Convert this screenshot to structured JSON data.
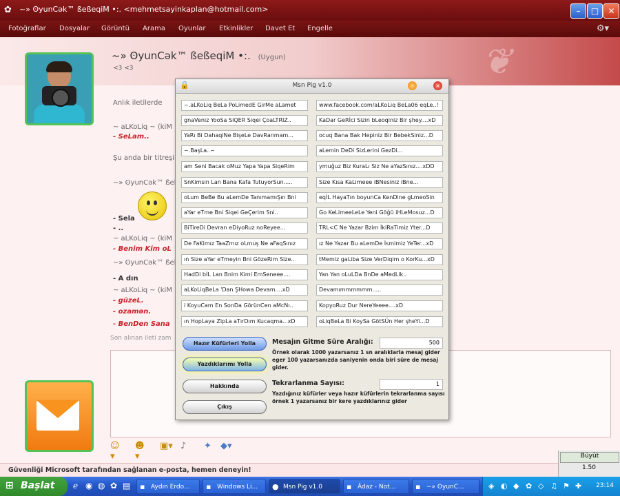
{
  "window": {
    "title": "~» ʘyunCək™ ßeßeqiM •:. <mehmetsayinkaplan@hotmail.com>",
    "minimize": "–",
    "maximize": "□",
    "close": "✕"
  },
  "menu": [
    "Fotoğraflar",
    "Dosyalar",
    "Görüntü",
    "Arama",
    "Oyunlar",
    "Etkinlikler",
    "Davet Et",
    "Engelle"
  ],
  "contact": {
    "name": "~» ʘyunCək™ ßeßeqiM •:.",
    "status": "(Uygun)",
    "sub": "<3 <3"
  },
  "conversation": {
    "lines": [
      {
        "text": "Anlık iletilerde",
        "style": "normal"
      },
      {
        "text": "~ aLKoLiq ~ (kiM",
        "style": "normal"
      },
      {
        "text": "- SeLam..",
        "style": "red"
      },
      {
        "text": "Şu anda bir titreşi",
        "style": "normal"
      },
      {
        "text": "~» ʘyunCək™ ßeb",
        "style": "normal"
      },
      {
        "text": "- Sela",
        "style": "dark"
      },
      {
        "text": "- ..",
        "style": "dark"
      },
      {
        "text": "~ aLKoLiq ~ (kiM",
        "style": "normal"
      },
      {
        "text": "- Benim Kim oL",
        "style": "red"
      },
      {
        "text": "~» ʘyunCək™ ßeb",
        "style": "normal"
      },
      {
        "text": "- A   dın",
        "style": "dark"
      },
      {
        "text": "~ aLKoLiq ~ (kiM",
        "style": "normal"
      },
      {
        "text": "- güzeL.",
        "style": "red"
      },
      {
        "text": "- ozamən.",
        "style": "red"
      },
      {
        "text": "- BenDen Sana",
        "style": "red"
      },
      {
        "text": "Son alınan ileti zam",
        "style": "normal"
      }
    ]
  },
  "ad": "Güvenliği Microsoft tarafından sağlanan e-posta, hemen deneyin!",
  "zoom": {
    "button": "Büyüt",
    "value": "1.50"
  },
  "dialog": {
    "title": "Msn Pig v1.0",
    "left_fields": [
      "~.aLKoLiq BeLa PoLimedE GirMe aLamet",
      "gnaVeniz YooSa SiQER Siqei ÇoaLTRIZ..",
      "YaRı Bi DahaqiNe BişeLe DavRanmam...",
      "~.BaşLa..~",
      "am Seni Bacak oMuz Yapa Yapa SiqeRim",
      "SnKimsin Lan Bana Kafa TutuyorSun.....",
      "oLum BeBe Bu aLemDe TanımamıŞın Bni",
      "aYar eTme Bni Siqei GeÇerim Sni..",
      "BiTireDi Devran eDiyoRuz noReyee...",
      "De FaKimız TaaZmız oLmuş Ne aFaqSınız",
      "ın Size aYar eTmeyin Bni GözeRim Size..",
      "HadDi bİL Lan Bnim Kimi EmSeneee....",
      "aLKoLiqBeLa 'Dan ŞHowa Devam....xD",
      "i KoyuCam En SonDa GörünCen aMcNı..",
      "ın HopLaya ZipLa aTırDım Kucaqma...xD"
    ],
    "right_fields": [
      "www.facebook.com/aLKoLiq BeLa06 eqLe..!",
      "KaDar GeRİci Sizin bLeoqiniz Bir şhey....xD",
      "ocuq Bana Bak Hepiniz Bir BebekSiniz...D",
      "aLemin DeDi SizLerini GezDi...",
      "ymuğuz Biz KuraLı Siz Ne aYazSınız....xDD",
      "Size Kısa KaLimeee iBNesiniz iBne...",
      "eqİL HayaTın boyunCa KenDine gLmeoSin",
      "Go KeLimeeLeLe Yeni Göğü iHLeMosuz...D",
      "TRL<C Ne Yazar Bzim İkiRaTimiz Yter...D",
      "ız Ne Yazar Bu aLemDe İsmimiz YeTer...xD",
      "tMemiz gaLiba Size VerDiqim o KorKu...xD",
      "Yan Yan oLuLDa BnDe aMedLik..",
      "Devamımmmmmm.....",
      "KopyoRuz Dur NereYeeee....xD",
      "oLiqBeLa Bi KoySa GötSÜn Her şheYi...D"
    ],
    "buttons": {
      "hazir": "Hazır Küfürleri Yolla",
      "yazdiklarimi": "Yazdıklarımı Yolla",
      "hakkinda": "Hakkında",
      "cikis": "Çıkış"
    },
    "interval": {
      "label": "Mesajın Gitme Süre Aralığı:",
      "value": "500",
      "desc": "Örnek olarak 1000 yazarsanız 1 sn aralıklarla mesaj gider eger 100 yazarsanızda saniyenin onda biri süre de mesaj gider."
    },
    "repeat": {
      "label": "Tekrarlanma Sayısı:",
      "value": "1",
      "desc": "Yazdığınız küfürler veya hazır küfürlerin tekrarlanma sayısı örnek 1 yazarsanız bir kere yazdıklarınız gider"
    }
  },
  "taskbar": {
    "start": "Başlat",
    "buttons": [
      {
        "label": "Aydın Erdo...",
        "active": false
      },
      {
        "label": "Windows Li...",
        "active": false
      },
      {
        "label": "Msn Pig v1.0",
        "active": true
      },
      {
        "label": "Âdaz - Not...",
        "active": false
      },
      {
        "label": "~» ʘyunC...",
        "active": false
      }
    ],
    "clock": "23:14"
  }
}
